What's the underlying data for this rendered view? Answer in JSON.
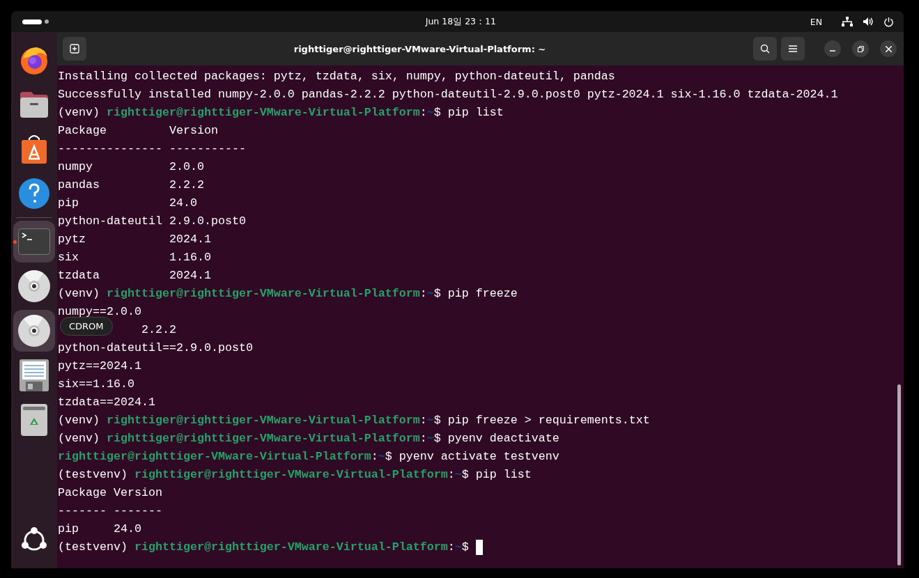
{
  "top_bar": {
    "clock": "Jun 18일 23：11",
    "input_source": "EN"
  },
  "dock": {
    "items": [
      {
        "kind": "firefox",
        "running": false,
        "highlighted": false
      },
      {
        "kind": "files",
        "running": false,
        "highlighted": false
      },
      {
        "kind": "store",
        "running": false,
        "highlighted": false
      },
      {
        "kind": "help",
        "running": false,
        "highlighted": false
      },
      {
        "kind": "separator"
      },
      {
        "kind": "terminal",
        "running": true,
        "highlighted": true
      },
      {
        "kind": "disc",
        "running": false,
        "highlighted": false
      },
      {
        "kind": "disc",
        "running": false,
        "highlighted": true
      },
      {
        "kind": "floppy",
        "running": false,
        "highlighted": false
      },
      {
        "kind": "trash",
        "running": false,
        "highlighted": false
      }
    ],
    "tooltip": "CDROM"
  },
  "window": {
    "title": "righttiger@righttiger-VMware-Virtual-Platform: ~"
  },
  "terminal": {
    "lines": [
      [
        {
          "kind": "plain",
          "text": "Installing collected packages: pytz, tzdata, six, numpy, python-dateutil, pandas"
        }
      ],
      [
        {
          "kind": "plain",
          "text": "Successfully installed numpy-2.0.0 pandas-2.2.2 python-dateutil-2.9.0.post0 pytz-2024.1 six-1.16.0 tzdata-2024.1"
        }
      ],
      [
        {
          "kind": "plain",
          "text": "(venv) "
        },
        {
          "kind": "user",
          "text": "righttiger@righttiger-VMware-Virtual-Platform"
        },
        {
          "kind": "plain",
          "text": ":"
        },
        {
          "kind": "path",
          "text": "~"
        },
        {
          "kind": "plain",
          "text": "$ pip list"
        }
      ],
      [
        {
          "kind": "plain",
          "text": "Package         Version"
        }
      ],
      [
        {
          "kind": "plain",
          "text": "--------------- -----------"
        }
      ],
      [
        {
          "kind": "plain",
          "text": "numpy           2.0.0"
        }
      ],
      [
        {
          "kind": "plain",
          "text": "pandas          2.2.2"
        }
      ],
      [
        {
          "kind": "plain",
          "text": "pip             24.0"
        }
      ],
      [
        {
          "kind": "plain",
          "text": "python-dateutil 2.9.0.post0"
        }
      ],
      [
        {
          "kind": "plain",
          "text": "pytz            2024.1"
        }
      ],
      [
        {
          "kind": "plain",
          "text": "six             1.16.0"
        }
      ],
      [
        {
          "kind": "plain",
          "text": "tzdata          2024.1"
        }
      ],
      [
        {
          "kind": "plain",
          "text": "(venv) "
        },
        {
          "kind": "user",
          "text": "righttiger@righttiger-VMware-Virtual-Platform"
        },
        {
          "kind": "plain",
          "text": ":"
        },
        {
          "kind": "path",
          "text": "~"
        },
        {
          "kind": "plain",
          "text": "$ pip freeze"
        }
      ],
      [
        {
          "kind": "plain",
          "text": "numpy==2.0.0"
        }
      ],
      [
        {
          "kind": "covered",
          "text": "2.2.2"
        }
      ],
      [
        {
          "kind": "plain",
          "text": "python-dateutil==2.9.0.post0"
        }
      ],
      [
        {
          "kind": "plain",
          "text": "pytz==2024.1"
        }
      ],
      [
        {
          "kind": "plain",
          "text": "six==1.16.0"
        }
      ],
      [
        {
          "kind": "plain",
          "text": "tzdata==2024.1"
        }
      ],
      [
        {
          "kind": "plain",
          "text": "(venv) "
        },
        {
          "kind": "user",
          "text": "righttiger@righttiger-VMware-Virtual-Platform"
        },
        {
          "kind": "plain",
          "text": ":"
        },
        {
          "kind": "path",
          "text": "~"
        },
        {
          "kind": "plain",
          "text": "$ pip freeze > requirements.txt"
        }
      ],
      [
        {
          "kind": "plain",
          "text": "(venv) "
        },
        {
          "kind": "user",
          "text": "righttiger@righttiger-VMware-Virtual-Platform"
        },
        {
          "kind": "plain",
          "text": ":"
        },
        {
          "kind": "path",
          "text": "~"
        },
        {
          "kind": "plain",
          "text": "$ pyenv deactivate"
        }
      ],
      [
        {
          "kind": "user",
          "text": "righttiger@righttiger-VMware-Virtual-Platform"
        },
        {
          "kind": "plain",
          "text": ":"
        },
        {
          "kind": "path",
          "text": "~"
        },
        {
          "kind": "plain",
          "text": "$ pyenv activate testvenv"
        }
      ],
      [
        {
          "kind": "plain",
          "text": "(testvenv) "
        },
        {
          "kind": "user",
          "text": "righttiger@righttiger-VMware-Virtual-Platform"
        },
        {
          "kind": "plain",
          "text": ":"
        },
        {
          "kind": "path",
          "text": "~"
        },
        {
          "kind": "plain",
          "text": "$ pip list"
        }
      ],
      [
        {
          "kind": "plain",
          "text": "Package Version"
        }
      ],
      [
        {
          "kind": "plain",
          "text": "------- -------"
        }
      ],
      [
        {
          "kind": "plain",
          "text": "pip     24.0"
        }
      ],
      [
        {
          "kind": "plain",
          "text": "(testvenv) "
        },
        {
          "kind": "user",
          "text": "righttiger@righttiger-VMware-Virtual-Platform"
        },
        {
          "kind": "plain",
          "text": ":"
        },
        {
          "kind": "path",
          "text": "~"
        },
        {
          "kind": "plain",
          "text": "$ "
        },
        {
          "kind": "cursor"
        }
      ]
    ]
  }
}
